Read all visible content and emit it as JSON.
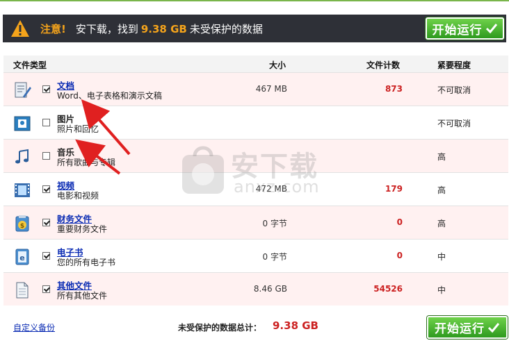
{
  "warning": {
    "label": "注意!",
    "text_before": "安下载，找到",
    "size": "9.38 GB",
    "text_after": "未受保护的数据"
  },
  "start_button_label": "开始运行",
  "table": {
    "headers": {
      "type": "文件类型",
      "size": "大小",
      "count": "文件计数",
      "priority": "紧要程度"
    },
    "rows": [
      {
        "name": "文档",
        "desc": "Word、电子表格和演示文稿",
        "size": "467 MB",
        "count": "873",
        "priority": "不可取消",
        "checked": true,
        "icon": "document-icon"
      },
      {
        "name": "图片",
        "desc": "照片和回忆",
        "size": "",
        "count": "",
        "priority": "不可取消",
        "checked": false,
        "icon": "picture-icon"
      },
      {
        "name": "音乐",
        "desc": "所有歌曲与专辑",
        "size": "",
        "count": "",
        "priority": "高",
        "checked": false,
        "icon": "music-icon"
      },
      {
        "name": "视频",
        "desc": "电影和视频",
        "size": "472 MB",
        "count": "179",
        "priority": "高",
        "checked": true,
        "icon": "video-icon"
      },
      {
        "name": "财务文件",
        "desc": "重要财务文件",
        "size": "0 字节",
        "count": "0",
        "priority": "高",
        "checked": true,
        "icon": "finance-icon"
      },
      {
        "name": "电子书",
        "desc": "您的所有电子书",
        "size": "0 字节",
        "count": "0",
        "priority": "中",
        "checked": true,
        "icon": "ebook-icon"
      },
      {
        "name": "其他文件",
        "desc": "所有其他文件",
        "size": "8.46 GB",
        "count": "54526",
        "priority": "中",
        "checked": true,
        "icon": "other-file-icon"
      }
    ]
  },
  "footer": {
    "custom_backup": "自定义备份",
    "total_label": "未受保护的数据总计：",
    "total_value": "9.38 GB"
  },
  "watermark": {
    "text": "安下载",
    "sub": "anxz.com"
  },
  "colors": {
    "warn_bar": "#2e3037",
    "accent_orange": "#f5a41b",
    "button_green": "#3cae2a",
    "count_red": "#cc2222",
    "link_blue": "#0a2bb3",
    "row_pink": "#fff1f1"
  }
}
